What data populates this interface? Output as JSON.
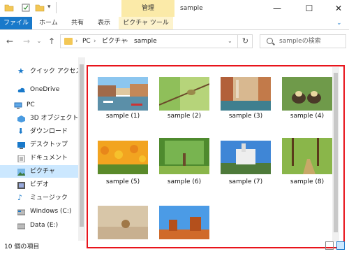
{
  "window": {
    "title": "sample",
    "context_tab_header": "管理",
    "controls": {
      "minimize": "—",
      "maximize": "☐",
      "close": "✕"
    }
  },
  "ribbon": {
    "file": "ファイル",
    "home": "ホーム",
    "share": "共有",
    "view": "表示",
    "picture_tools": "ピクチャ ツール"
  },
  "address": {
    "back": "←",
    "forward": "→",
    "up": "↑",
    "crumbs": [
      "PC",
      "ピクチャ",
      "sample"
    ],
    "separator": "›",
    "refresh": "↻",
    "search_placeholder": "sampleの検索"
  },
  "nav": {
    "items": [
      {
        "label": "クイック アクセス",
        "icon": "star-icon"
      },
      {
        "label": "OneDrive",
        "icon": "cloud-icon"
      },
      {
        "label": "PC",
        "icon": "computer-icon"
      },
      {
        "label": "3D オブジェクト",
        "icon": "cube-icon"
      },
      {
        "label": "ダウンロード",
        "icon": "download-icon"
      },
      {
        "label": "デスクトップ",
        "icon": "desktop-icon"
      },
      {
        "label": "ドキュメント",
        "icon": "document-icon"
      },
      {
        "label": "ピクチャ",
        "icon": "pictures-icon"
      },
      {
        "label": "ビデオ",
        "icon": "video-icon"
      },
      {
        "label": "ミュージック",
        "icon": "music-icon"
      },
      {
        "label": "Windows (C:)",
        "icon": "drive-icon"
      },
      {
        "label": "Data (E:)",
        "icon": "drive-icon"
      }
    ],
    "selected": "ピクチャ"
  },
  "files": [
    {
      "name": "sample (1)",
      "subject": "canal with boats"
    },
    {
      "name": "sample (2)",
      "subject": "bird on branch"
    },
    {
      "name": "sample (3)",
      "subject": "venice canal"
    },
    {
      "name": "sample (4)",
      "subject": "ducklings"
    },
    {
      "name": "sample (5)",
      "subject": "tulip field"
    },
    {
      "name": "sample (6)",
      "subject": "green trees"
    },
    {
      "name": "sample (7)",
      "subject": "castle"
    },
    {
      "name": "sample (8)",
      "subject": "forest path"
    },
    {
      "name": "",
      "subject": "snail on sand"
    },
    {
      "name": "",
      "subject": "desert buttes"
    }
  ],
  "status": {
    "item_count": "10 個の項目"
  },
  "colors": {
    "accent": "#1979ca",
    "context_tab": "#fbeaa8",
    "highlight_border": "#e8141b",
    "nav_selected": "#cce8ff"
  }
}
